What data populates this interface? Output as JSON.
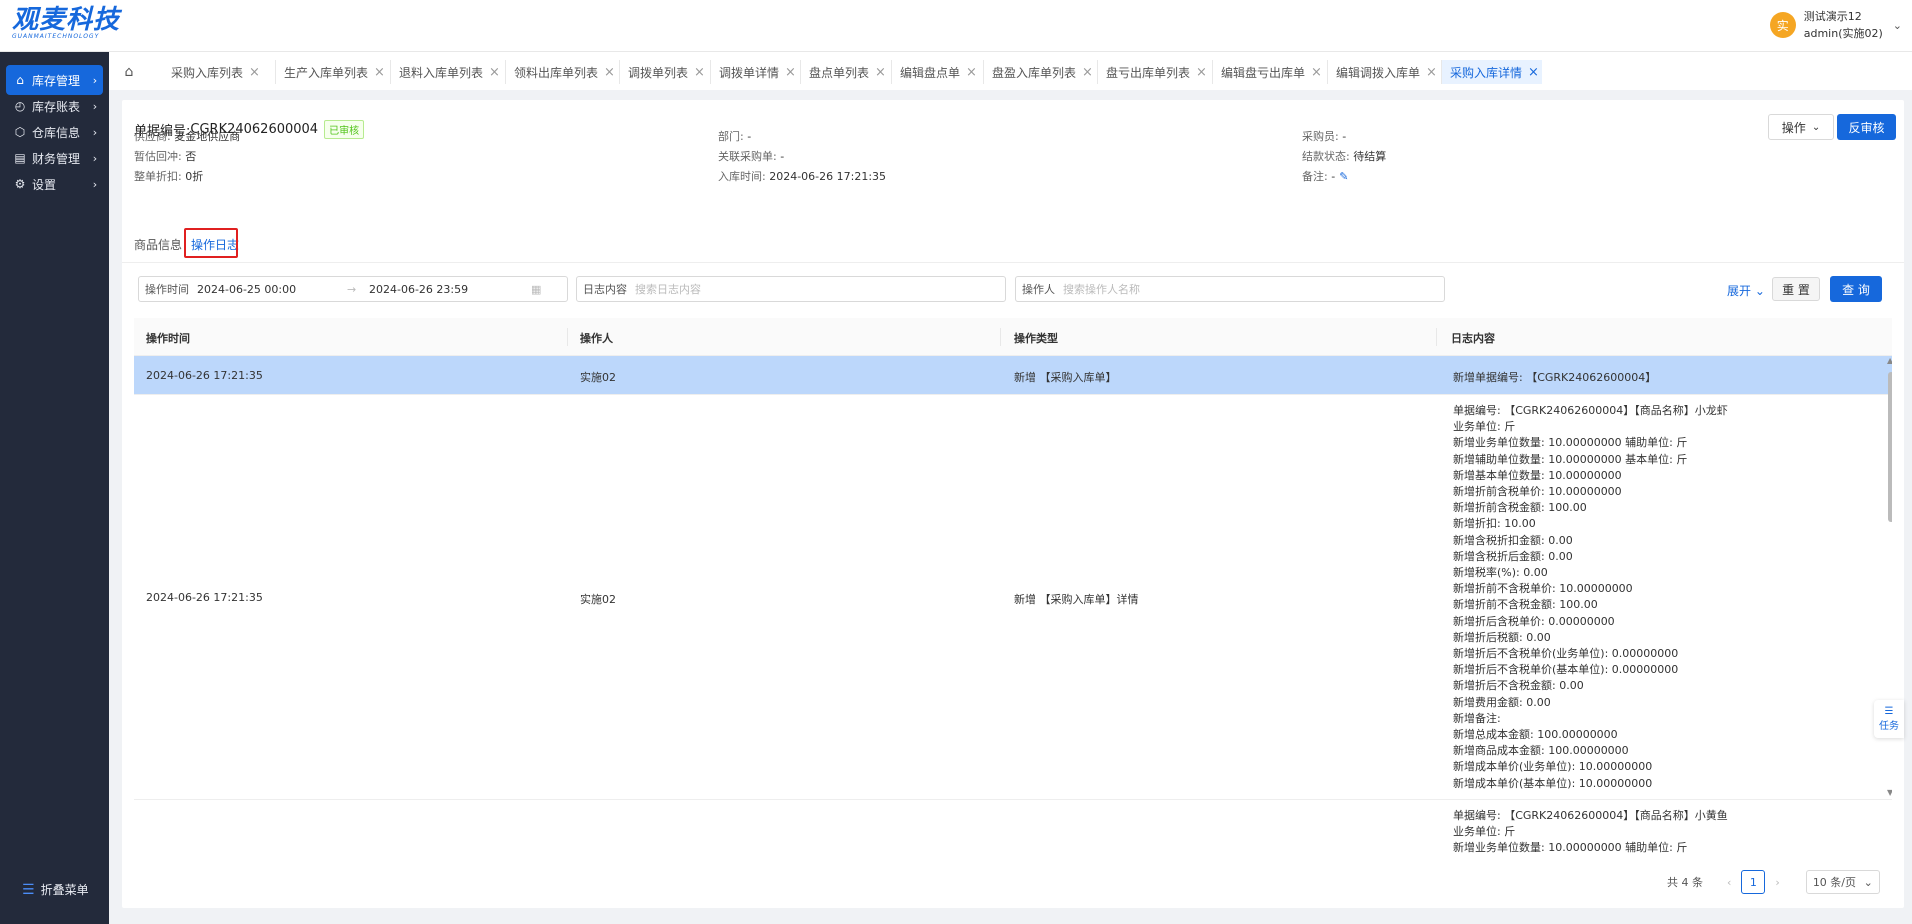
{
  "logo": {
    "main": "观麦科技",
    "sub": "GUANMAITECHNOLOGY"
  },
  "user": {
    "avatar": "实",
    "name": "测试演示12",
    "role": "admin(实施02)",
    "icon": "chevron-down-icon"
  },
  "sidebar": {
    "items": [
      {
        "label": "库存管理",
        "icon": "warehouse-icon",
        "active": true
      },
      {
        "label": "库存账表",
        "icon": "ledger-icon",
        "active": false
      },
      {
        "label": "仓库信息",
        "icon": "box-icon",
        "active": false
      },
      {
        "label": "财务管理",
        "icon": "finance-icon",
        "active": false
      },
      {
        "label": "设置",
        "icon": "gear-icon",
        "active": false
      }
    ],
    "collapse_label": "折叠菜单"
  },
  "tabs": [
    {
      "label": "采购入库列表"
    },
    {
      "label": "生产入库单列表"
    },
    {
      "label": "退料入库单列表"
    },
    {
      "label": "领料出库单列表"
    },
    {
      "label": "调拨单列表"
    },
    {
      "label": "调拨单详情"
    },
    {
      "label": "盘点单列表"
    },
    {
      "label": "编辑盘点单"
    },
    {
      "label": "盘盈入库单列表"
    },
    {
      "label": "盘亏出库单列表"
    },
    {
      "label": "编辑盘亏出库单"
    },
    {
      "label": "编辑调拨入库单"
    },
    {
      "label": "采购入库详情",
      "active": true
    }
  ],
  "header": {
    "doc_no_label": "单据编号: ",
    "doc_no": "CGRK24062600004",
    "status_badge": "已审核",
    "operate_label": "操作",
    "unaudit_label": "反审核"
  },
  "info": {
    "supplier": {
      "k": "供应商: ",
      "v": "麦金地供应商"
    },
    "department": {
      "k": "部门: ",
      "v": "-"
    },
    "buyer": {
      "k": "采购员: ",
      "v": "-"
    },
    "offset": {
      "k": "暂估回冲: ",
      "v": "否"
    },
    "related_po": {
      "k": "关联采购单: ",
      "v": "-"
    },
    "settle_status": {
      "k": "结款状态: ",
      "v": "待结算"
    },
    "discount": {
      "k": "整单折扣: ",
      "v": "0折"
    },
    "in_time": {
      "k": "入库时间: ",
      "v": "2024-06-26 17:21:35"
    },
    "remark": {
      "k": "备注: ",
      "v": "-"
    }
  },
  "detail_tabs": [
    {
      "label": "商品信息"
    },
    {
      "label": "操作日志",
      "active": true
    }
  ],
  "filters": {
    "time_label": "操作时间",
    "time_start": "2024-06-25 00:00",
    "time_sep": "→",
    "time_end": "2024-06-26 23:59",
    "content_label": "日志内容",
    "content_placeholder": "搜索日志内容",
    "operator_label": "操作人",
    "operator_placeholder": "搜索操作人名称",
    "expand_label": "展开",
    "reset_label": "重 置",
    "query_label": "查 询"
  },
  "table": {
    "columns": [
      "操作时间",
      "操作人",
      "操作类型",
      "日志内容"
    ],
    "rows": [
      {
        "time": "2024-06-26 17:21:35",
        "operator": "实施02",
        "type": "新增 【采购入库单】",
        "content": [
          "新增单据编号: 【CGRK24062600004】"
        ]
      },
      {
        "time": "2024-06-26 17:21:35",
        "operator": "实施02",
        "type": "新增 【采购入库单】详情",
        "content": [
          "单据编号: 【CGRK24062600004】【商品名称】小龙虾",
          "业务单位: 斤",
          "新增业务单位数量: 10.00000000 辅助单位: 斤",
          "新增辅助单位数量: 10.00000000 基本单位: 斤",
          "新增基本单位数量: 10.00000000",
          "新增折前含税单价: 10.00000000",
          "新增折前含税金额: 100.00",
          "新增折扣: 10.00",
          "新增含税折扣金额: 0.00",
          "新增含税折后金额: 0.00",
          "新增税率(%): 0.00",
          "新增折前不含税单价: 10.00000000",
          "新增折前不含税金额: 100.00",
          "新增折后含税单价: 0.00000000",
          "新增折后税额: 0.00",
          "新增折后不含税单价(业务单位): 0.00000000",
          "新增折后不含税单价(基本单位): 0.00000000",
          "新增折后不含税金额: 0.00",
          "新增费用金额: 0.00",
          "新增备注: ",
          "新增总成本金额: 100.00000000",
          "新增商品成本金额: 100.00000000",
          "新增成本单价(业务单位): 10.00000000",
          "新增成本单价(基本单位): 10.00000000"
        ]
      },
      {
        "time": "",
        "operator": "",
        "type": "",
        "content": [
          "单据编号: 【CGRK24062600004】【商品名称】小黄鱼",
          "业务单位: 斤",
          "新增业务单位数量: 10.00000000 辅助单位: 斤"
        ]
      }
    ]
  },
  "pagination": {
    "total": "共 4 条",
    "current": "1",
    "page_size": "10 条/页"
  },
  "task_float": {
    "label": "任务",
    "icon": "layers-icon"
  },
  "colors": {
    "primary": "#1668dc",
    "sidebar_bg": "#232a3b",
    "selected_row": "#bcd7fb",
    "highlight_box": "#e02020"
  }
}
